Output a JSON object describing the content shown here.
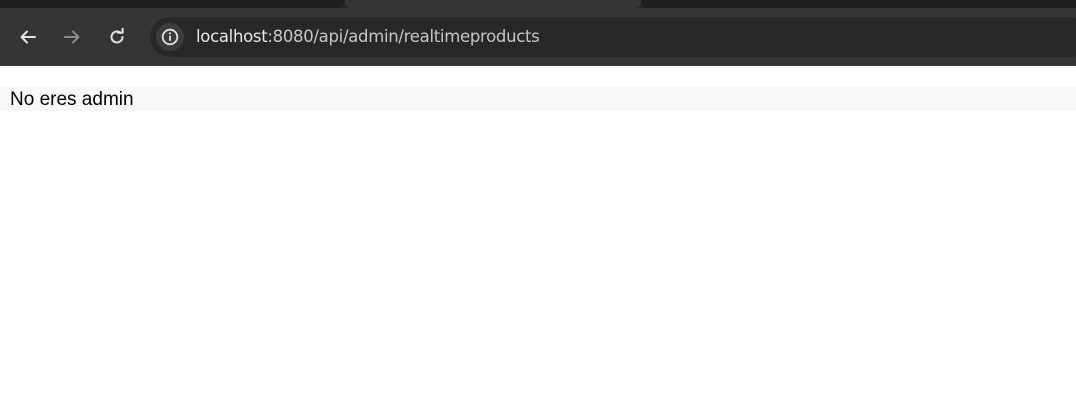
{
  "browser": {
    "url_host": "localhost",
    "url_path": ":8080/api/admin/realtimeproducts",
    "icons": {
      "back": "arrow-left-icon",
      "forward": "arrow-right-icon",
      "reload": "reload-icon",
      "site_info": "info-icon"
    }
  },
  "page": {
    "message": "No eres admin"
  }
}
